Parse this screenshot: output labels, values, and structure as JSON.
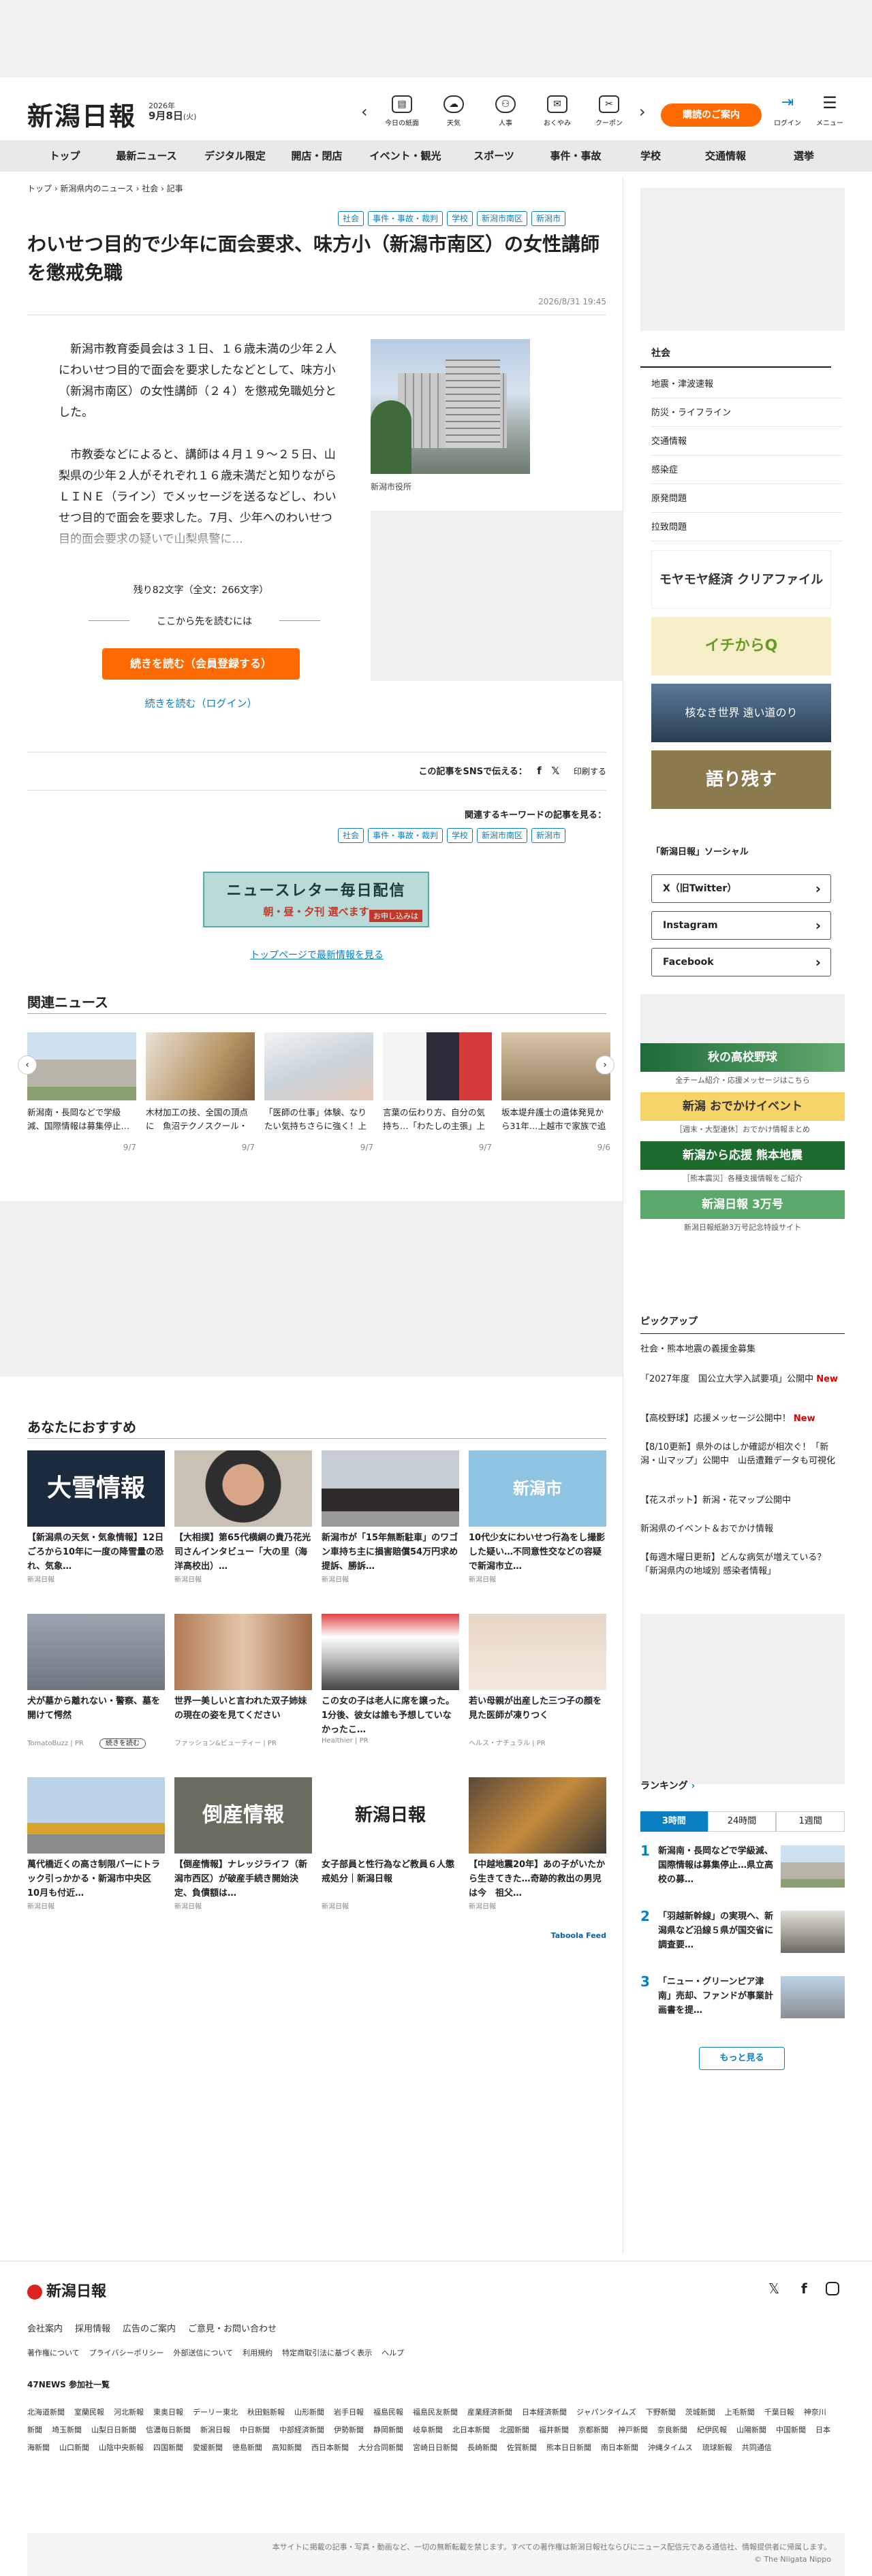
{
  "header": {
    "logo": "新潟日報",
    "date_year": "2026年",
    "date_md": "9月8日",
    "date_dow": "(火)",
    "icons": [
      {
        "label": "今日の紙面",
        "icon": "newspaper-icon"
      },
      {
        "label": "天気",
        "icon": "weather-icon"
      },
      {
        "label": "人事",
        "icon": "people-icon"
      },
      {
        "label": "おくやみ",
        "icon": "envelope-icon"
      },
      {
        "label": "クーポン",
        "icon": "coupon-icon"
      }
    ],
    "subscribe": "購読のご案内",
    "login": "ログイン",
    "menu": "メニュー"
  },
  "gnav": [
    "トップ",
    "最新ニュース",
    "デジタル限定",
    "開店・閉店",
    "イベント・観光",
    "スポーツ",
    "事件・事故",
    "学校",
    "交通情報",
    "選挙"
  ],
  "breadcrumb": "トップ › 新潟県内のニュース › 社会 › 記事",
  "article": {
    "tags": [
      "社会",
      "事件・事故・裁判",
      "学校",
      "新潟市南区",
      "新潟市"
    ],
    "title": "わいせつ目的で少年に面会要求、味方小（新潟市南区）の女性講師を懲戒免職",
    "date": "2026/8/31 19:45",
    "p1": "新潟市教育委員会は３１日、１６歳未満の少年２人にわいせつ目的で面会を要求したなどとして、味方小（新潟市南区）の女性講師（２４）を懲戒免職処分とした。",
    "p2": "市教委などによると、講師は４月１９～２５日、山梨県の少年２人がそれぞれ１６歳未満だと知りながらＬＩＮＥ（ライン）でメッセージを送るなどし、わいせつ目的で面会を要求した。7月、少年へのわいせつ目的面会要求の疑いで山梨県警に...",
    "caption": "新潟市役所",
    "remaining": "残り82文字（全文：266文字）",
    "continue": "ここから先を読むには",
    "read_button": "続きを読む（会員登録する）",
    "login_link": "続きを読む（ログイン）",
    "sns_label": "この記事をSNSで伝える：",
    "print": "印刷する",
    "keyword_label": "関連するキーワードの記事を見る：",
    "newsletter_title": "ニュースレター毎日配信",
    "newsletter_sub": "朝・昼・夕刊 選べます",
    "newsletter_cta": "お申し込みは",
    "top_link": "トップページで最新情報を見る"
  },
  "related": {
    "heading": "関連ニュース",
    "items": [
      {
        "title": "新潟南・長岡などで学級減、国際情報は募集停止…県立高校の募集…",
        "date": "9/7"
      },
      {
        "title": "木材加工の技、全国の頂点に　魚沼テクノスクール・藤木さんが「…",
        "date": "9/7"
      },
      {
        "title": "「医師の仕事」体験、なりたい気持ちさらに強く！上越市・県立中…",
        "date": "9/7"
      },
      {
        "title": "言葉の伝わり方、自分の気持ち…「わたしの主張」上越・糸魚川地…",
        "date": "9/7"
      },
      {
        "title": "坂本堤弁護士の遺体発見から31年…上越市で家族で追悼の会を「事…",
        "date": "9/6"
      }
    ]
  },
  "recommend": {
    "heading": "あなたにおすすめ",
    "items": [
      {
        "title": "【新潟県の天気・気象情報】12日ごろから10年に一度の降雪量の恐れ、気象…",
        "src": "新潟日報"
      },
      {
        "title": "【大相撲】第65代横綱の貴乃花光司さんインタビュー「大の里（海洋高校出）…",
        "src": "新潟日報"
      },
      {
        "title": "新潟市が「15年無断駐車」のワゴン車持ち主に損害賠償54万円求め提訴、勝訴…",
        "src": "新潟日報"
      },
      {
        "title": "10代少女にわいせつ行為をし撮影した疑い…不同意性交などの容疑で新潟市立…",
        "src": "新潟日報"
      },
      {
        "title": "犬が墓から離れない・警察、墓を開けて愕然",
        "src": "TomatoBuzz | PR"
      },
      {
        "title": "世界一美しいと言われた双子姉妹の現在の姿を見てください",
        "src": "ファッション&ビューティー | PR"
      },
      {
        "title": "この女の子は老人に席を譲った。 1分後、彼女は誰も予想していなかったこ…",
        "src": "Healthier | PR"
      },
      {
        "title": "若い母親が出産した三つ子の顔を見た医師が凍りつく",
        "src": "ヘルス・ナチュラル | PR"
      },
      {
        "title": "萬代橋近くの高さ制限バーにトラック引っかかる・新潟市中央区　10月も付近…",
        "src": "新潟日報"
      },
      {
        "title": "【倒産情報】ナレッジライフ（新潟市西区）が破産手続き開始決定、負債額は…",
        "src": "新潟日報"
      },
      {
        "title": "女子部員と性行為など教員６人懲戒処分｜新潟日報",
        "src": "新潟日報"
      },
      {
        "title": "【中越地震20年】あの子がいたから生きてきた…奇跡的救出の男児は今　祖父…",
        "src": "新潟日報"
      }
    ],
    "badge_readmore": "続きを読む",
    "taboola": "Taboola Feed",
    "img_snow": "大雪情報",
    "img_niigata": "新潟市",
    "img_bankrupt": "倒産情報",
    "img_logo": "新潟日報"
  },
  "sidebar": {
    "category_title": "社会",
    "category_items": [
      "地震・津波速報",
      "防災・ライフライン",
      "交通情報",
      "感染症",
      "原発問題",
      "拉致問題"
    ],
    "banners": [
      "モヤモヤ経済 クリアファイル",
      "イチからQ",
      "核なき世界 遠い道のり",
      "語り残す"
    ],
    "social_title": "「新潟日報」ソーシャル",
    "social": [
      "X（旧Twitter）",
      "Instagram",
      "Facebook"
    ],
    "banners2": [
      {
        "title": "秋の高校野球",
        "sub": "全チーム紹介・応援メッセージはこちら"
      },
      {
        "title": "新潟 おでかけイベント",
        "sub": "［週末・大型連休］おでかけ情報まとめ"
      },
      {
        "title": "新潟から応援 熊本地震",
        "sub": "［熊本震災］各種支援情報をご紹介"
      },
      {
        "title": "新潟日報 3万号",
        "sub": "新潟日報紙齢3万号記念特設サイト"
      }
    ],
    "pickup_title": "ピックアップ",
    "pickup": [
      {
        "text": "社会・熊本地震の義援金募集",
        "new": ""
      },
      {
        "text": "「2027年度　国公立大学入試要項」公開中",
        "new": "New"
      },
      {
        "text": "【高校野球】応援メッセージ公開中！",
        "new": "New"
      },
      {
        "text": "【8/10更新】県外のはしか確認が相次ぐ！「新潟・山マップ」公開中　山岳遭難データも可視化",
        "new": ""
      },
      {
        "text": "【花スポット】新潟・花マップ公開中",
        "new": ""
      },
      {
        "text": "新潟県のイベント＆おでかけ情報",
        "new": ""
      },
      {
        "text": "【毎週木曜日更新】どんな病気が増えている？「新潟県内の地域別 感染者情報」",
        "new": ""
      }
    ],
    "ranking_title": "ランキング",
    "ranking_tabs": [
      "3時間",
      "24時間",
      "1週間"
    ],
    "ranking": [
      {
        "n": "1",
        "text": "新潟南・長岡などで学級減、国際情報は募集停止…県立高校の募…"
      },
      {
        "n": "2",
        "text": "「羽越新幹線」の実現へ、新潟県など沿線５県が国交省に調査要…"
      },
      {
        "n": "3",
        "text": "「ニュー・グリーンピア津南」売却、ファンドが事業計画書を提…"
      }
    ],
    "more": "もっと見る"
  },
  "footer": {
    "logo": "新潟日報",
    "links1": [
      "会社案内",
      "採用情報",
      "広告のご案内",
      "ご意見・お問い合わせ"
    ],
    "links2": [
      "著作権について",
      "プライバシーポリシー",
      "外部送信について",
      "利用規約",
      "特定商取引法に基づく表示",
      "ヘルプ"
    ],
    "papers_title": "47NEWS 参加社一覧",
    "papers": [
      "北海道新聞",
      "室蘭民報",
      "河北新報",
      "東奥日報",
      "デーリー東北",
      "秋田魁新報",
      "山形新聞",
      "岩手日報",
      "福島民報",
      "福島民友新聞",
      "産業経済新聞",
      "日本経済新聞",
      "ジャパンタイムズ",
      "下野新聞",
      "茨城新聞",
      "上毛新聞",
      "千葉日報",
      "神奈川新聞",
      "埼玉新聞",
      "山梨日日新聞",
      "信濃毎日新聞",
      "新潟日報",
      "中日新聞",
      "中部経済新聞",
      "伊勢新聞",
      "静岡新聞",
      "岐阜新聞",
      "北日本新聞",
      "北國新聞",
      "福井新聞",
      "京都新聞",
      "神戸新聞",
      "奈良新聞",
      "紀伊民報",
      "山陽新聞",
      "中国新聞",
      "日本海新聞",
      "山口新聞",
      "山陰中央新報",
      "四国新聞",
      "愛媛新聞",
      "徳島新聞",
      "高知新聞",
      "西日本新聞",
      "大分合同新聞",
      "宮崎日日新聞",
      "長崎新聞",
      "佐賀新聞",
      "熊本日日新聞",
      "南日本新聞",
      "沖縄タイムス",
      "琉球新報",
      "共同通信"
    ],
    "copyright_note": "本サイトに掲載の記事・写真・動画など、一切の無断転載を禁じます。すべての著作権は新潟日報社ならびにニュース配信元である通信社、情報提供者に帰属します。",
    "copyright": "© The Niigata Nippo"
  }
}
